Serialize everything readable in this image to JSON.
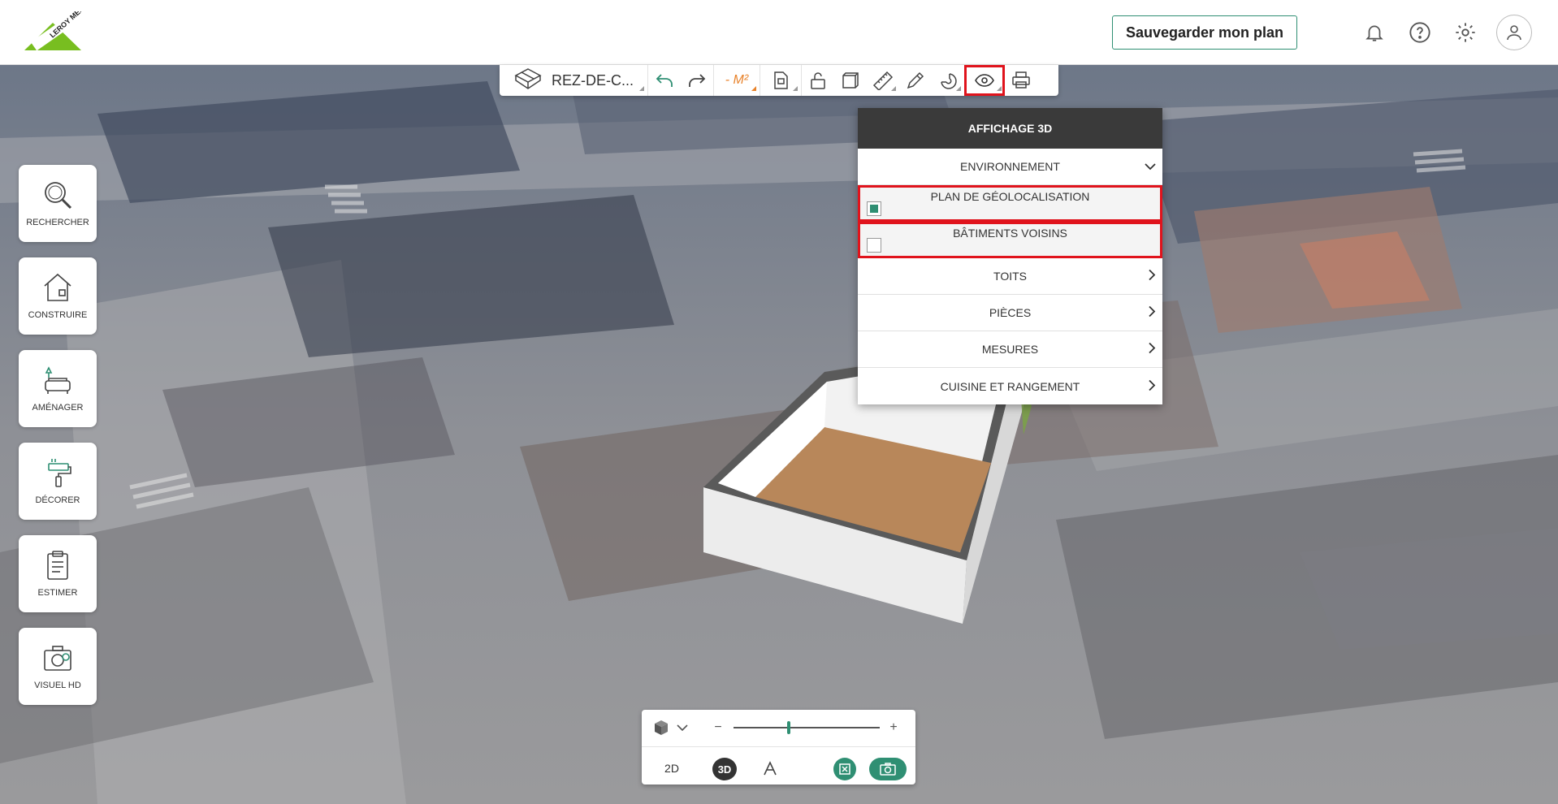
{
  "header": {
    "logo_text": "LEROY MERLIN",
    "save_label": "Sauvegarder mon plan",
    "icons": [
      "bell-icon",
      "help-icon",
      "gear-icon",
      "user-icon"
    ]
  },
  "toolbar": {
    "level_label": "REZ-DE-C...",
    "m2_label": "- M²",
    "icons": [
      "level-cube-icon",
      "undo-icon",
      "redo-icon",
      "m2-icon",
      "floor-plan-icon",
      "unlock-icon",
      "cube-icon",
      "ruler-icon",
      "pencil-icon",
      "magnet-icon",
      "eye-icon",
      "print-icon"
    ],
    "accent": "#e8822a"
  },
  "dropdown": {
    "title": "AFFICHAGE 3D",
    "environment_label": "ENVIRONNEMENT",
    "environment_items": [
      {
        "label": "PLAN DE GÉOLOCALISATION",
        "checked": true
      },
      {
        "label": "BÂTIMENTS VOISINS",
        "checked": false
      }
    ],
    "sections": [
      "TOITS",
      "PIÈCES",
      "MESURES",
      "CUISINE ET RANGEMENT"
    ]
  },
  "sidebar": {
    "items": [
      {
        "label": "RECHERCHER",
        "icon": "search-icon"
      },
      {
        "label": "CONSTRUIRE",
        "icon": "house-icon"
      },
      {
        "label": "AMÉNAGER",
        "icon": "sofa-icon"
      },
      {
        "label": "DÉCORER",
        "icon": "paint-roller-icon"
      },
      {
        "label": "ESTIMER",
        "icon": "clipboard-icon"
      },
      {
        "label": "VISUEL HD",
        "icon": "camera-icon"
      }
    ]
  },
  "view_controls": {
    "zoom_out": "−",
    "zoom_in": "+",
    "zoom_level": 0.38,
    "mode_2d": "2D",
    "mode_3d": "3D",
    "active_mode": "3D"
  },
  "colors": {
    "brand_green": "#2f8f73",
    "highlight_red": "#e0131c"
  }
}
